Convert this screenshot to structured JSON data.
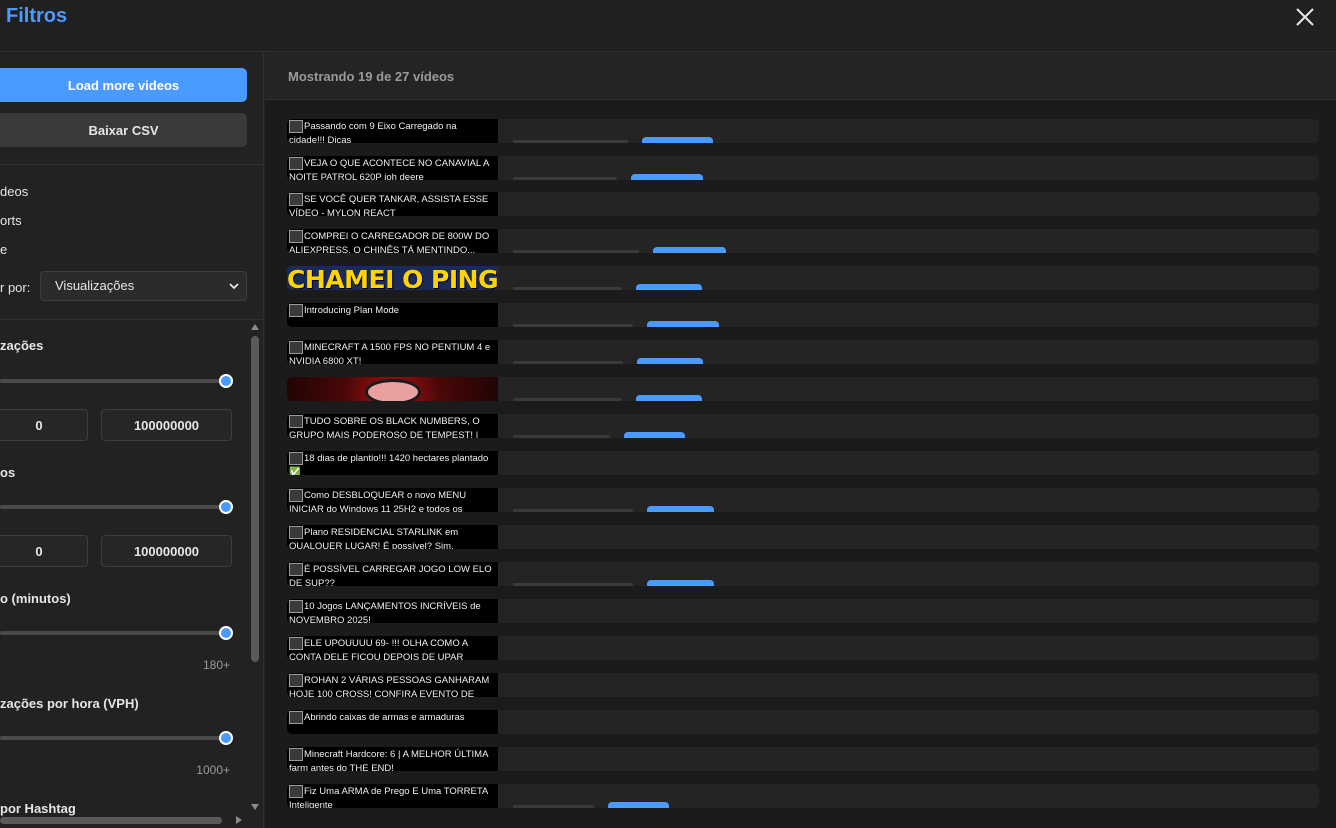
{
  "header": {
    "title": "Filtros"
  },
  "sidebar": {
    "load_more_label": "Load more videos",
    "csv_label": "Baixar CSV",
    "checkboxes": [
      "deos",
      "orts",
      "e"
    ],
    "sort_label": "r por:",
    "sort_value": "Visualizações",
    "sections": [
      {
        "title": "zações",
        "min": "0",
        "max": "100000000"
      },
      {
        "title": "os",
        "min": "0",
        "max": "100000000"
      },
      {
        "title": "o (minutos)",
        "max_label": "180+"
      },
      {
        "title": "zações por hora (VPH)",
        "max_label": "1000+"
      },
      {
        "title": "por Hashtag"
      }
    ]
  },
  "main": {
    "count_text": "Mostrando 19 de 27 vídeos",
    "videos": [
      {
        "title": "Passando com 9 Eixo Carregado na cidade!!! Dicas"
      },
      {
        "title": "VEJA O QUE ACONTECE NO CANAVIAL A NOITE PATROL 620P ioh deere"
      },
      {
        "title": "SE VOCÊ QUER TANKAR, ASSISTA ESSE VÍDEO - MYLON REACT"
      },
      {
        "title": "COMPREI O CARREGADOR DE 800W DO ALIEXPRESS. O CHINÊS TÁ MENTINDO..."
      },
      {
        "title": "CHAMEI O PINGUIM",
        "image": "pinguim"
      },
      {
        "title": "Introducing Plan Mode"
      },
      {
        "title": "MINECRAFT A 1500 FPS NO PENTIUM 4 e NVIDIA 6800 XT!"
      },
      {
        "title": "",
        "image": "red"
      },
      {
        "title": "TUDO SOBRE OS BLACK NUMBERS, O GRUPO MAIS PODEROSO DE TEMPEST! |"
      },
      {
        "title": "18 dias de plantio!!! 1420 hectares plantado ✅"
      },
      {
        "title": "Como DESBLOQUEAR o novo MENU INICIAR do Windows 11 25H2 e todos os"
      },
      {
        "title": "Plano RESIDENCIAL STARLINK em QUALQUER LUGAR! É possível? Sim."
      },
      {
        "title": "É POSSÍVEL CARREGAR JOGO LOW ELO DE SUP??"
      },
      {
        "title": "10 Jogos LANÇAMENTOS INCRÍVEIS de NOVEMBRO 2025!"
      },
      {
        "title": "ELE UPOUUUU 69- !!! OLHA COMO A CONTA DELE FICOU DEPOIS DE UPAR"
      },
      {
        "title": "ROHAN 2 VÁRIAS PESSOAS GANHARAM HOJE 100 CROSS! CONFIRA EVENTO DE"
      },
      {
        "title": "Abrindo caixas de armas e armaduras"
      },
      {
        "title": "Minecraft Hardcore: 6 | A MELHOR ÚLTIMA farm antes do THE END!"
      },
      {
        "title": "Fiz Uma ARMA de Prego E Uma TORRETA Inteligente"
      }
    ]
  },
  "colors": {
    "accent": "#4a9bff",
    "background": "#1b1b1b",
    "panel": "#222222"
  }
}
